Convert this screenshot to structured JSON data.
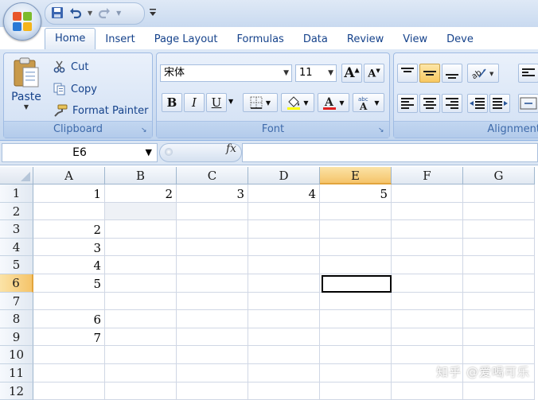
{
  "quick_access": {
    "save_icon": "save-icon",
    "undo_icon": "undo-icon",
    "redo_icon": "redo-icon",
    "customize_icon": "customize-icon"
  },
  "tabs": [
    {
      "label": "Home",
      "active": true
    },
    {
      "label": "Insert"
    },
    {
      "label": "Page Layout"
    },
    {
      "label": "Formulas"
    },
    {
      "label": "Data"
    },
    {
      "label": "Review"
    },
    {
      "label": "View"
    },
    {
      "label": "Deve"
    }
  ],
  "clipboard": {
    "paste_label": "Paste",
    "cut_label": "Cut",
    "copy_label": "Copy",
    "format_painter_label": "Format Painter",
    "group_label": "Clipboard"
  },
  "font": {
    "font_name": "宋体",
    "font_size": "11",
    "bold": "B",
    "italic": "I",
    "underline": "U",
    "group_label": "Font"
  },
  "alignment": {
    "group_label": "Alignment"
  },
  "formula_bar": {
    "name_box": "E6",
    "fx_label": "fx",
    "formula": ""
  },
  "sheet": {
    "columns": [
      "A",
      "B",
      "C",
      "D",
      "E",
      "F",
      "G"
    ],
    "selected_column": "E",
    "rows": [
      "1",
      "2",
      "3",
      "4",
      "5",
      "6",
      "7",
      "8",
      "9",
      "10",
      "11",
      "12"
    ],
    "selected_row": "6",
    "cells": {
      "A1": "1",
      "B1": "2",
      "C1": "3",
      "D1": "4",
      "E1": "5",
      "A3": "2",
      "A4": "3",
      "A5": "4",
      "A6": "5",
      "A8": "6",
      "A9": "7"
    },
    "active_cell": "E6"
  },
  "watermark": "知乎 @爱喝可乐",
  "colors": {
    "accent": "#15428b",
    "selected_header": "#f5c46a",
    "ribbon_bg": "#cddcf1"
  }
}
